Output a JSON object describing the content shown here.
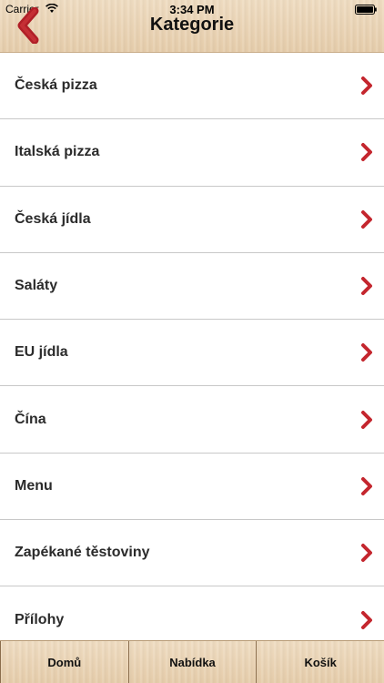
{
  "status": {
    "carrier": "Carrier",
    "time": "3:34 PM"
  },
  "header": {
    "title": "Kategorie",
    "back_icon": "chevron-left-icon",
    "accent_color": "#c4262e"
  },
  "categories": [
    {
      "label": "Česká pizza"
    },
    {
      "label": "Italská pizza"
    },
    {
      "label": "Česká jídla"
    },
    {
      "label": "Saláty"
    },
    {
      "label": "EU jídla"
    },
    {
      "label": "Čína"
    },
    {
      "label": "Menu"
    },
    {
      "label": "Zapékané těstoviny"
    },
    {
      "label": "Přílohy"
    }
  ],
  "tabbar": {
    "tabs": [
      {
        "label": "Domů"
      },
      {
        "label": "Nabídka"
      },
      {
        "label": "Košík"
      }
    ]
  }
}
